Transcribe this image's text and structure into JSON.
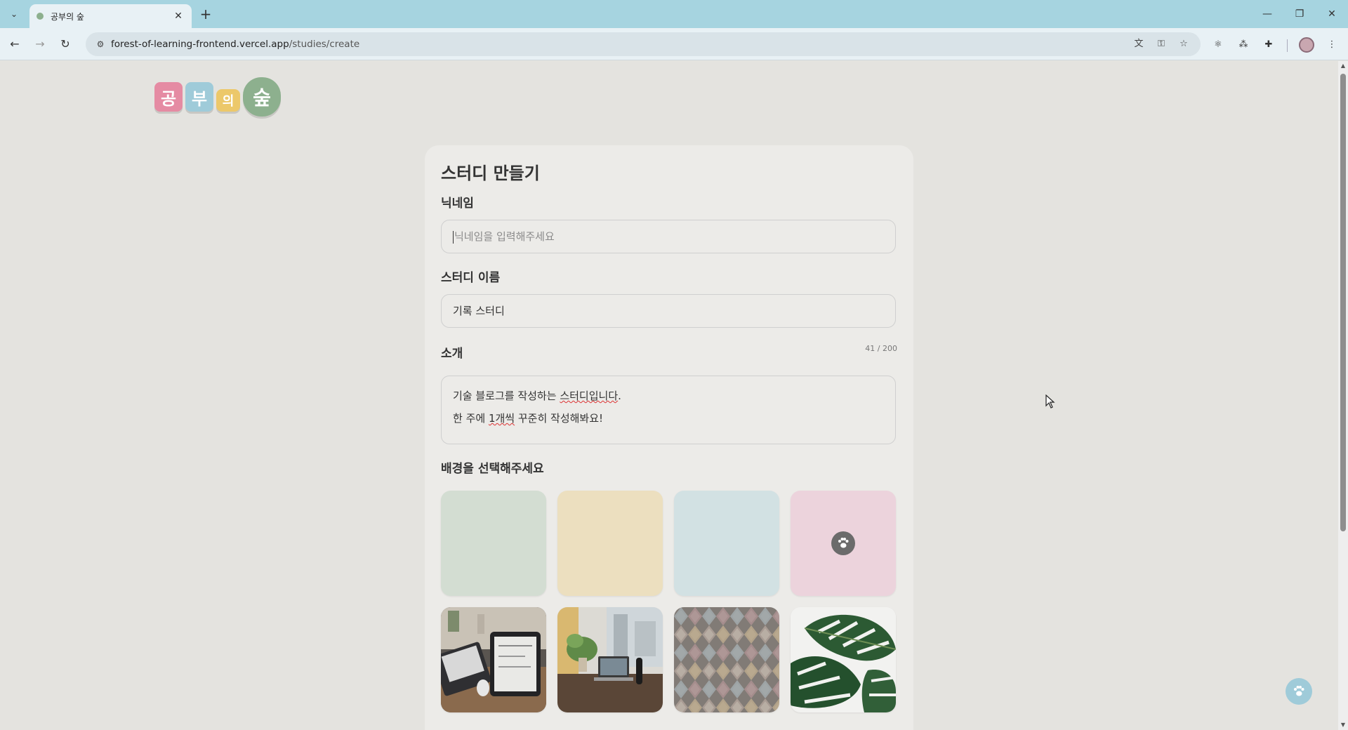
{
  "browser": {
    "tab_title": "공부의 숲",
    "url_host": "forest-of-learning-frontend.vercel.app",
    "url_path": "/studies/create"
  },
  "logo": {
    "chars": [
      "공",
      "부",
      "의",
      "숲"
    ]
  },
  "form": {
    "title": "스터디 만들기",
    "nickname": {
      "label": "닉네임",
      "placeholder": "닉네임을 입력해주세요",
      "value": ""
    },
    "study_name": {
      "label": "스터디 이름",
      "value": "기록 스터디"
    },
    "intro": {
      "label": "소개",
      "counter": "41 / 200",
      "line1_a": "기술 블로그를 작성하는 ",
      "line1_b": "스터디입니다",
      "line1_c": ".",
      "line2_a": "한 주에 ",
      "line2_b": "1개씩",
      "line2_c": " 꾸준히 작성해봐요!"
    },
    "background": {
      "label": "배경을 선택해주세요",
      "colors": [
        "#d3ddd2",
        "#ecdfbf",
        "#d2e1e3",
        "#ecd3dc"
      ],
      "selected_index": 3,
      "photos": [
        "desk-tablet-photo",
        "laptop-plant-photo",
        "tile-pattern-photo",
        "monstera-leaf-photo"
      ]
    }
  }
}
